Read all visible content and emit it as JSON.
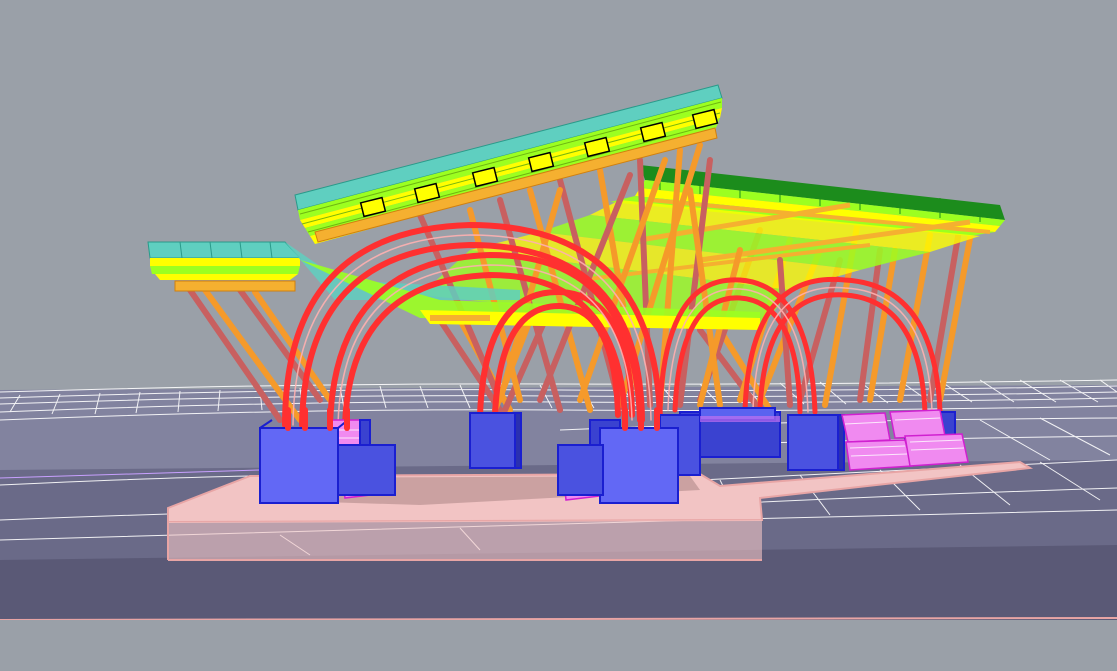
{
  "viewport": {
    "title": "",
    "display_mode": "wireframe-colored",
    "colors": {
      "background": "#9aa0a8",
      "ground_grid": "#ffffff",
      "ground_fill": "#7e7f9c",
      "ground_fill_dark": "#5b5a78",
      "platform": "#f2c4c4",
      "platform_edge": "#e8a5a5",
      "plinth": "#5a63f0",
      "plinth_edge": "#1a1fd0",
      "seat": "#f08af0",
      "seat_edge": "#d020d0",
      "arch": "#ff3030",
      "arch_edge": "#e00000",
      "column_orange": "#f59a2a",
      "column_brown": "#c86060",
      "roof_top": "#5fcfc0",
      "roof_yellow": "#ffff00",
      "roof_green": "#9cff20",
      "roof_dark_green": "#1c8c1c",
      "beam": "#f5b030"
    },
    "scene_objects": [
      "ground-grid",
      "platform",
      "plinths",
      "arches",
      "columns",
      "roof-canopy",
      "seats"
    ]
  }
}
